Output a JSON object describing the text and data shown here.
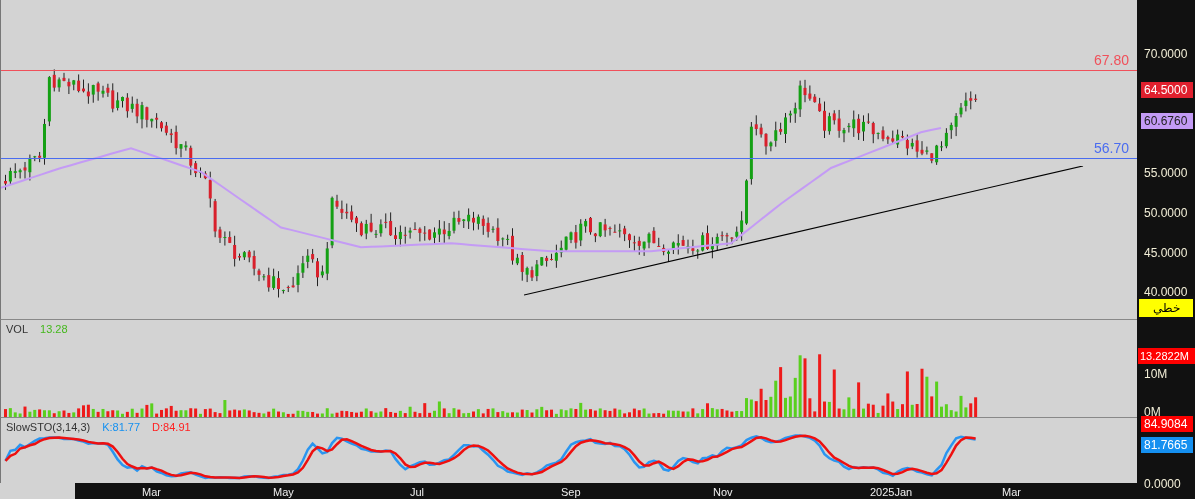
{
  "price_pane": {
    "y_ticks": [
      "70.0000",
      "55.0000",
      "50.0000",
      "45.0000",
      "40.0000"
    ],
    "levels": [
      {
        "label": "67.80",
        "color": "#f0505a"
      },
      {
        "label": "56.70",
        "color": "#4a6cf0"
      }
    ],
    "badges": [
      {
        "label": "64.5000",
        "color": "#e0202e"
      },
      {
        "label": "60.6760",
        "color": "#c39bf5"
      }
    ],
    "button": "خطي"
  },
  "volume_pane": {
    "title": "VOL",
    "value": "13.28",
    "y_ticks": [
      "10M",
      "0M"
    ],
    "badge": "13.2822M"
  },
  "stochastic_pane": {
    "title": "SlowSTO(3,14,3)",
    "k": "K:81.77",
    "d": "D:84.91",
    "y_ticks": [
      "0.0000"
    ],
    "badges": [
      {
        "label": "84.9084",
        "color": "#ff0000"
      },
      {
        "label": "81.7665",
        "color": "#1590f0"
      }
    ]
  },
  "time_axis": [
    "Mar",
    "May",
    "Jul",
    "Sep",
    "Nov",
    "2025Jan",
    "Mar"
  ]
}
